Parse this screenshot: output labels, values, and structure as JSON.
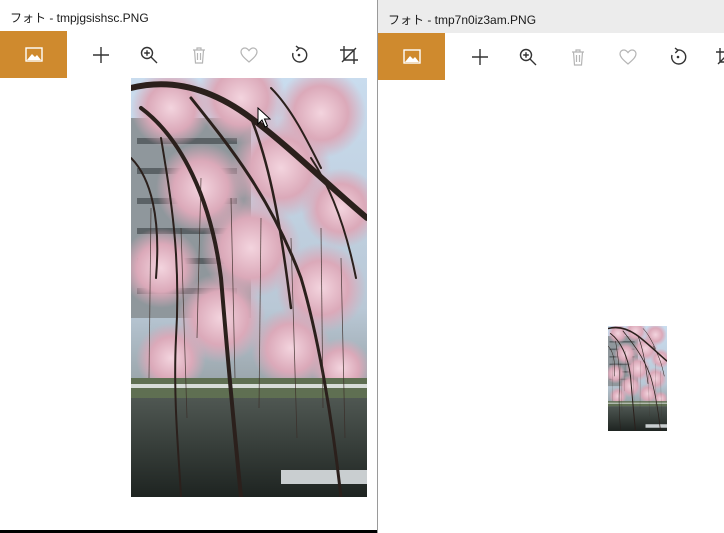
{
  "windows": [
    {
      "id": "left",
      "title": "フォト - tmpjgsishsc.PNG",
      "toolbar": [
        "photo-tile",
        "add",
        "zoom",
        "delete",
        "favorite",
        "rotate",
        "crop"
      ]
    },
    {
      "id": "right",
      "title": "フォト - tmp7n0iz3am.PNG",
      "toolbar": [
        "photo-tile",
        "add",
        "zoom",
        "delete",
        "favorite",
        "rotate",
        "crop"
      ]
    }
  ],
  "colors": {
    "accent": "#cf8a2e",
    "icon": "#333333",
    "icon_disabled": "#b5b5b5"
  },
  "icons": {
    "photo_tile": "image-icon",
    "add": "plus-icon",
    "zoom": "zoom-in-icon",
    "delete": "trash-icon",
    "favorite": "heart-icon",
    "rotate": "rotate-icon",
    "crop": "crop-icon"
  }
}
